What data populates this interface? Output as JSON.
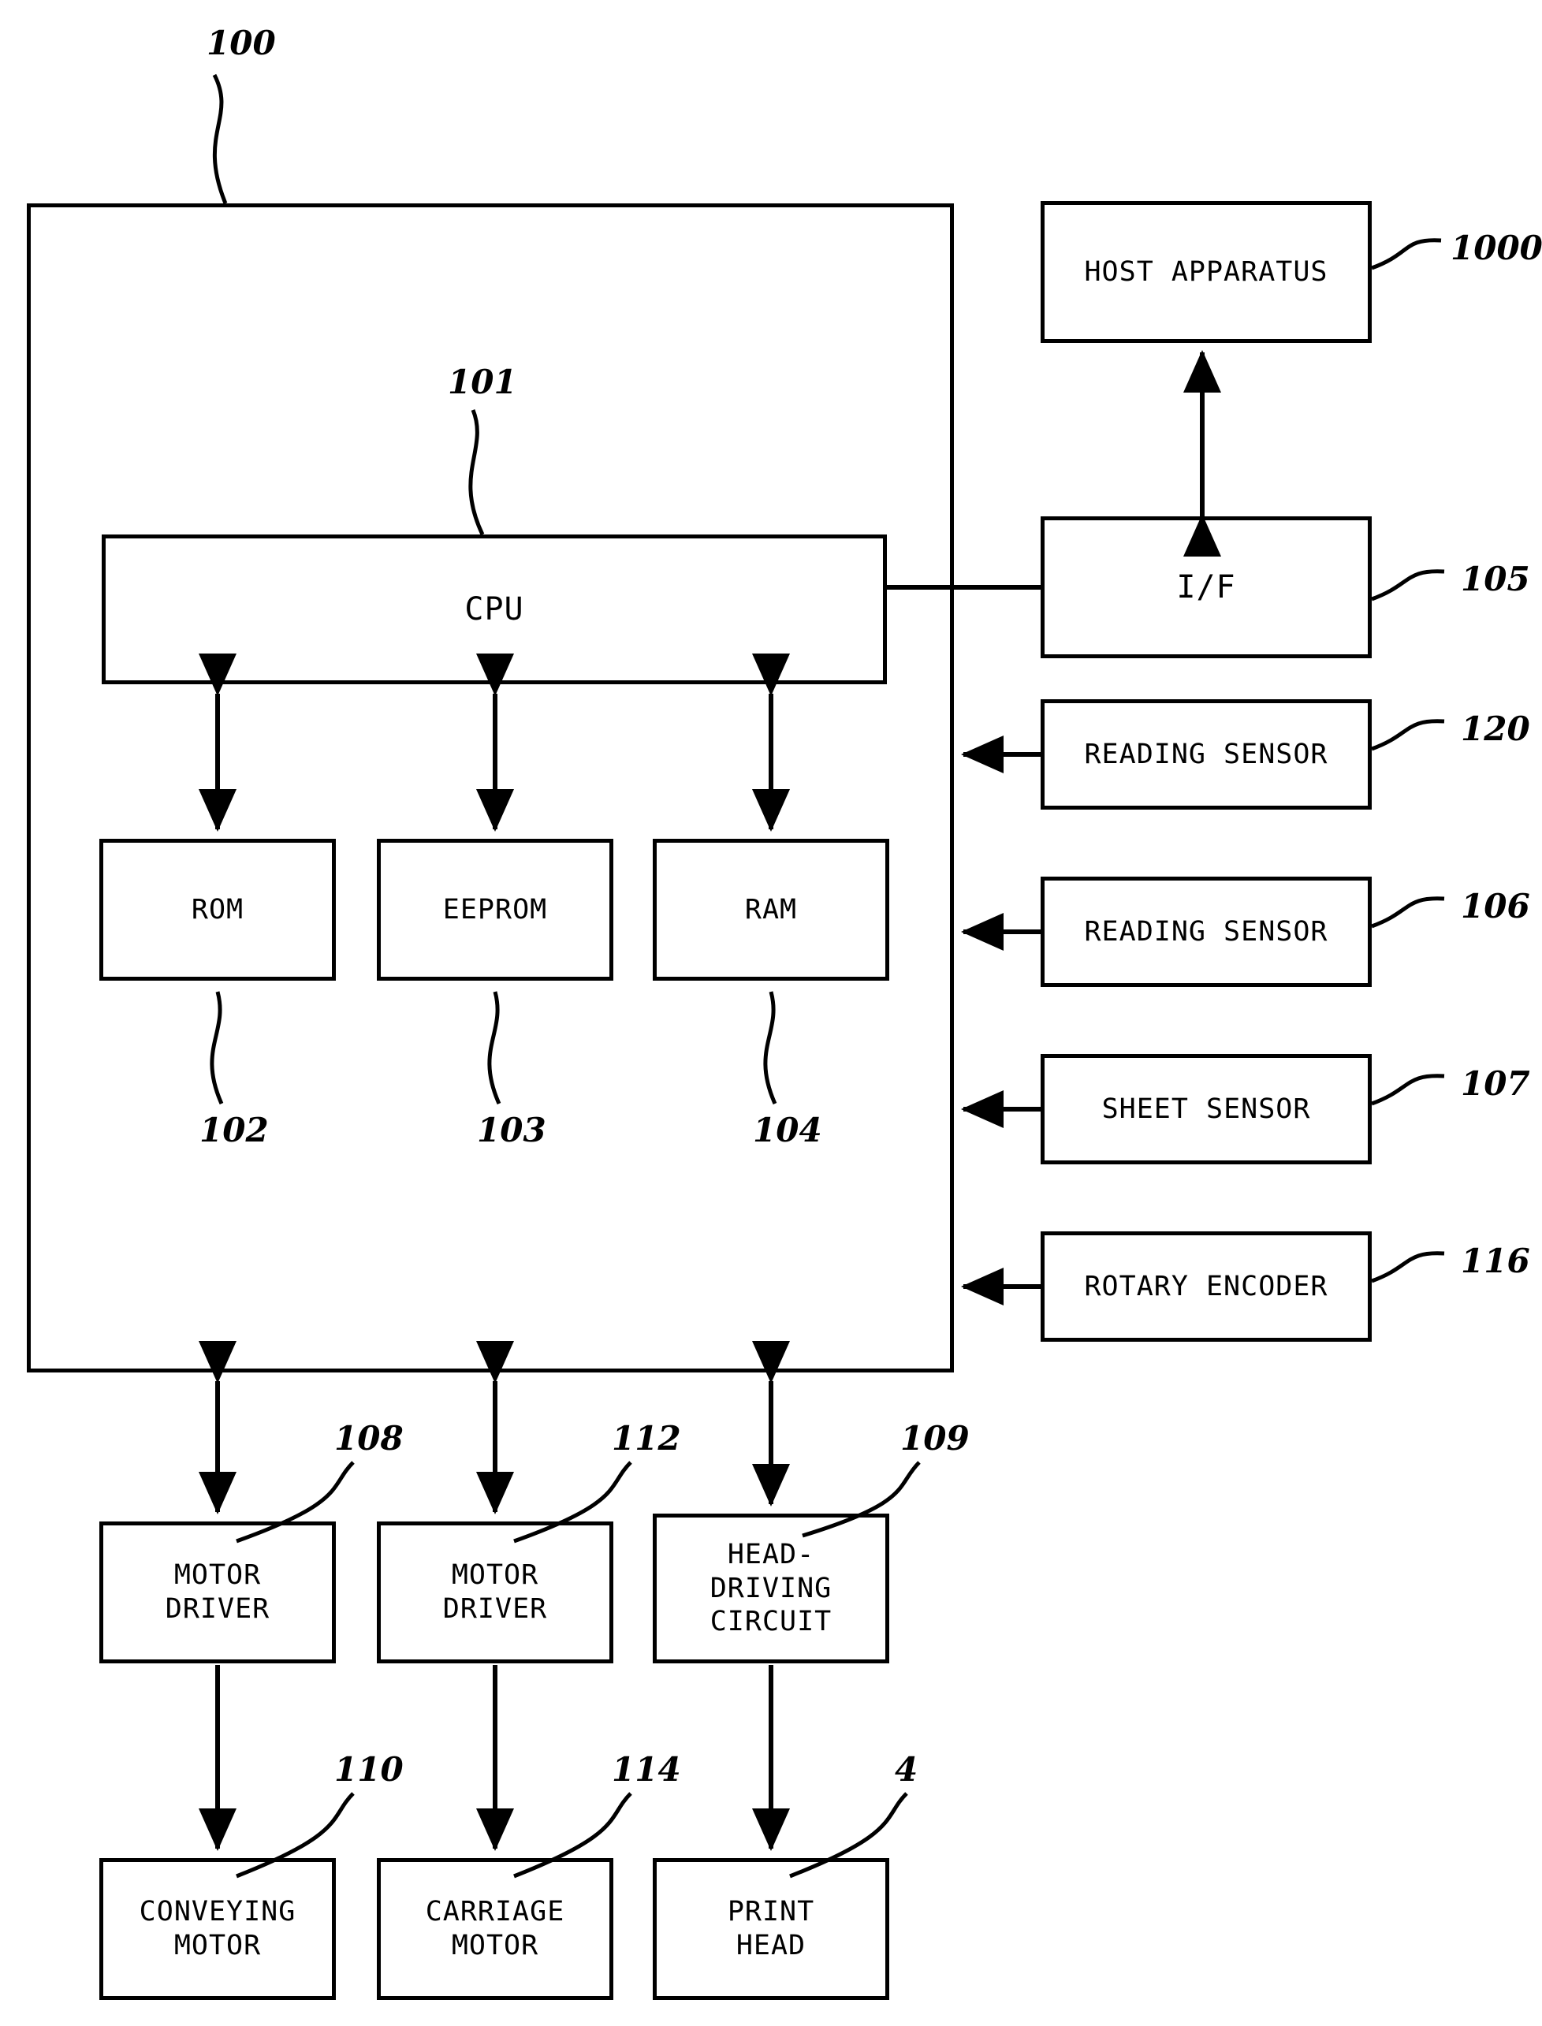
{
  "diagram": {
    "title_ref": "100",
    "controller_ref": "100",
    "blocks": {
      "cpu": {
        "label": "CPU",
        "ref": "101"
      },
      "rom": {
        "label": "ROM",
        "ref": "102"
      },
      "eeprom": {
        "label": "EEPROM",
        "ref": "103"
      },
      "ram": {
        "label": "RAM",
        "ref": "104"
      },
      "host": {
        "label": "HOST APPARATUS",
        "ref": "1000"
      },
      "interface": {
        "label": "I/F",
        "ref": "105"
      },
      "reading_sensor_120": {
        "label": "READING SENSOR",
        "ref": "120"
      },
      "reading_sensor_106": {
        "label": "READING SENSOR",
        "ref": "106"
      },
      "sheet_sensor": {
        "label": "SHEET SENSOR",
        "ref": "107"
      },
      "rotary_encoder": {
        "label": "ROTARY ENCODER",
        "ref": "116"
      },
      "motor_driver_108": {
        "label": "MOTOR\nDRIVER",
        "ref": "108"
      },
      "motor_driver_112": {
        "label": "MOTOR\nDRIVER",
        "ref": "112"
      },
      "head_driving_circuit": {
        "label": "HEAD-\nDRIVING\nCIRCUIT",
        "ref": "109"
      },
      "conveying_motor": {
        "label": "CONVEYING\nMOTOR",
        "ref": "110"
      },
      "carriage_motor": {
        "label": "CARRIAGE\nMOTOR",
        "ref": "114"
      },
      "print_head": {
        "label": "PRINT\nHEAD",
        "ref": "4"
      }
    }
  }
}
